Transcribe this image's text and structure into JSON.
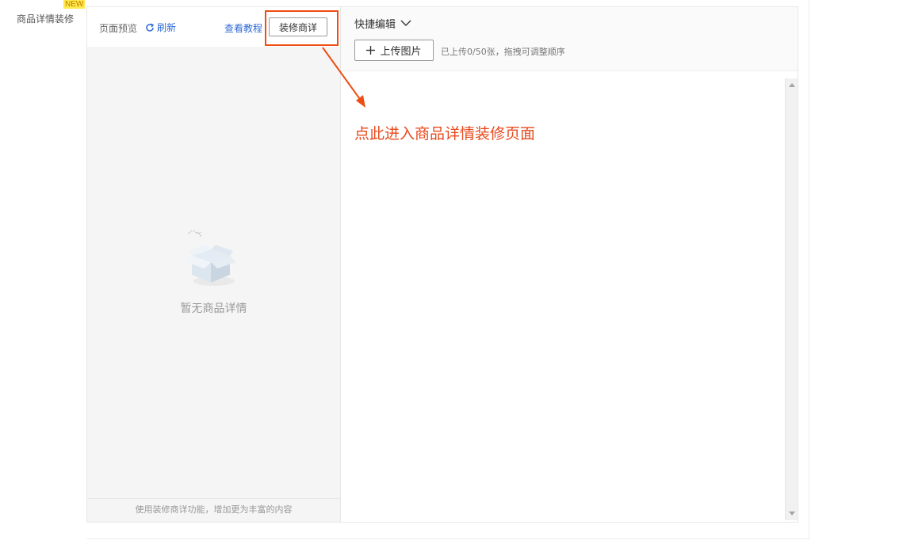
{
  "sidebar": {
    "item_label": "商品详情装修",
    "new_badge": "NEW"
  },
  "preview": {
    "title": "页面预览",
    "refresh_label": "刷新",
    "tutorial_link": "查看教程",
    "decorate_button": "装修商详",
    "empty_text": "暂无商品详情",
    "footer_text": "使用装修商详功能，增加更为丰富的内容"
  },
  "quick_edit": {
    "title": "快捷编辑",
    "upload_button": "上传图片",
    "upload_hint": "已上传0/50张，拖拽可调整顺序"
  },
  "annotation": {
    "text": "点此进入商品详情装修页面",
    "color": "#e8491d"
  },
  "colors": {
    "accent_link": "#2e6bd6",
    "highlight": "#ee4e14",
    "badge": "#ffe94d"
  }
}
